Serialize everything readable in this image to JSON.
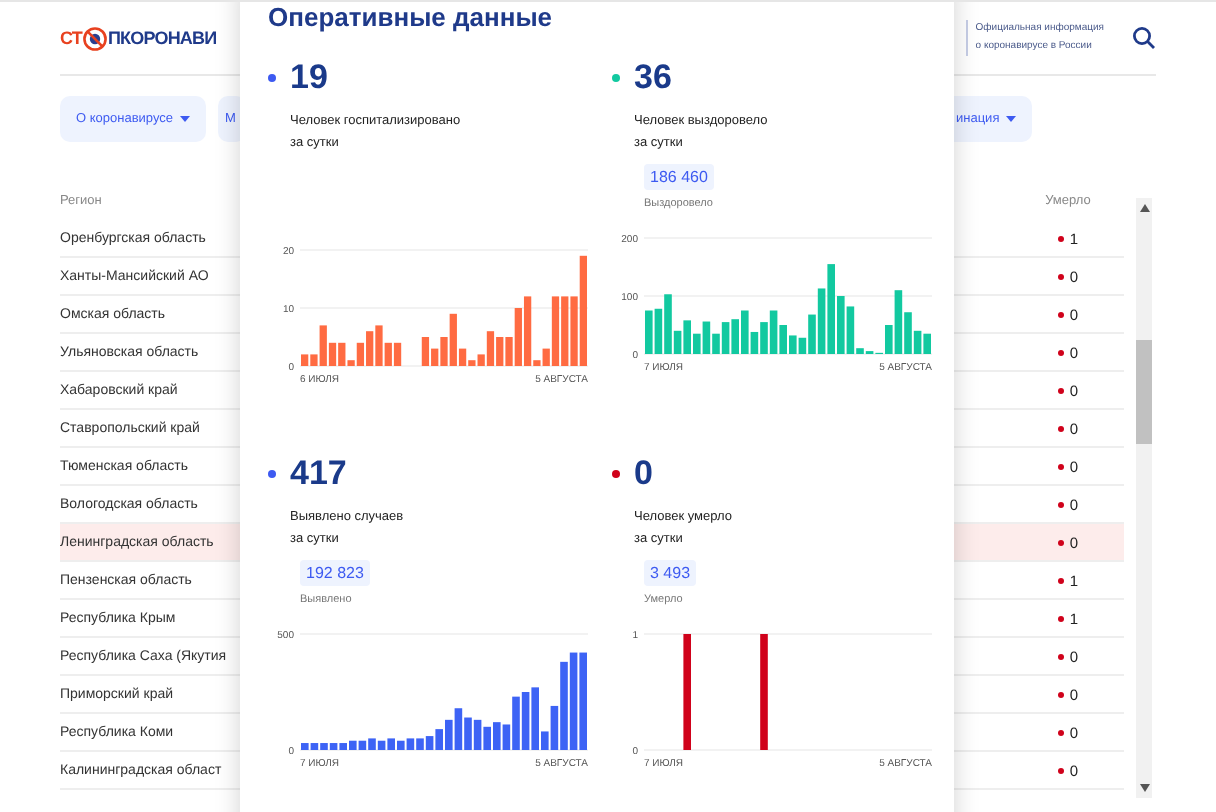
{
  "header": {
    "logo_left": "СТ",
    "logo_right": "ПКОРОНАВИ",
    "tagline": "Официальная информация\nо коронавирусе в России"
  },
  "nav": [
    {
      "label": "О коронавирусе",
      "caret": true
    },
    {
      "label": "М",
      "caret": false
    },
    {
      "label": "инация",
      "caret": true
    }
  ],
  "table": {
    "columns": [
      "Регион",
      "Умерло"
    ],
    "rows": [
      {
        "region": "Оренбургская область",
        "deaths": "1",
        "selected": false
      },
      {
        "region": "Ханты-Мансийский АО",
        "deaths": "0",
        "selected": false
      },
      {
        "region": "Омская область",
        "deaths": "0",
        "selected": false
      },
      {
        "region": "Ульяновская область",
        "deaths": "0",
        "selected": false
      },
      {
        "region": "Хабаровский край",
        "deaths": "0",
        "selected": false
      },
      {
        "region": "Ставропольский край",
        "deaths": "0",
        "selected": false
      },
      {
        "region": "Тюменская область",
        "deaths": "0",
        "selected": false
      },
      {
        "region": "Вологодская область",
        "deaths": "0",
        "selected": false
      },
      {
        "region": "Ленинградская область",
        "deaths": "0",
        "selected": true
      },
      {
        "region": "Пензенская область",
        "deaths": "1",
        "selected": false
      },
      {
        "region": "Республика Крым",
        "deaths": "1",
        "selected": false
      },
      {
        "region": "Республика Саха (Якутия",
        "deaths": "0",
        "selected": false
      },
      {
        "region": "Приморский край",
        "deaths": "0",
        "selected": false
      },
      {
        "region": "Республика Коми",
        "deaths": "0",
        "selected": false
      },
      {
        "region": "Калининградская област",
        "deaths": "0",
        "selected": false
      }
    ]
  },
  "popup": {
    "title": "Оперативные данные",
    "stats": [
      {
        "value": "19",
        "label": "Человек госпитализировано\nза сутки",
        "color": "#3d5af1",
        "axis_start": "6 ИЮЛЯ",
        "axis_end": "5 АВГУСТА",
        "chart_data": {
          "type": "bar",
          "yticks": [
            0,
            10,
            20
          ],
          "ylim": [
            0,
            20
          ],
          "series": [
            {
              "color": "#ff6b42",
              "values": [
                2,
                2,
                7,
                4,
                4,
                1,
                4,
                6,
                7,
                4,
                4,
                null,
                null,
                5,
                3,
                5,
                9,
                3,
                1,
                2,
                6,
                5,
                5,
                10,
                12,
                1,
                3,
                12,
                12,
                12,
                19
              ]
            }
          ]
        }
      },
      {
        "value": "36",
        "label": "Человек выздоровело\nза сутки",
        "total": "186 460",
        "total_label": "Выздоровело",
        "color": "#12c9a0",
        "axis_start": "7 ИЮЛЯ",
        "axis_end": "5 АВГУСТА",
        "chart_data": {
          "type": "bar",
          "yticks": [
            0,
            100,
            200
          ],
          "ylim": [
            0,
            200
          ],
          "series": [
            {
              "color": "#12c9a0",
              "values": [
                75,
                78,
                103,
                40,
                58,
                35,
                56,
                35,
                55,
                60,
                75,
                38,
                55,
                75,
                50,
                32,
                28,
                68,
                113,
                155,
                100,
                82,
                10,
                5,
                2,
                50,
                110,
                72,
                40,
                35
              ]
            }
          ]
        }
      },
      {
        "value": "417",
        "label": "Выявлено случаев\nза сутки",
        "total": "192 823",
        "total_label": "Выявлено",
        "color": "#3d5af1",
        "axis_start": "7 ИЮЛЯ",
        "axis_end": "5 АВГУСТА",
        "chart_data": {
          "type": "bar",
          "yticks": [
            0,
            500
          ],
          "ylim": [
            0,
            500
          ],
          "series": [
            {
              "color": "#3d63f5",
              "values": [
                30,
                30,
                30,
                30,
                30,
                40,
                40,
                50,
                40,
                50,
                40,
                50,
                50,
                60,
                90,
                130,
                180,
                140,
                130,
                100,
                120,
                110,
                230,
                250,
                270,
                80,
                190,
                380,
                420,
                420
              ]
            }
          ]
        }
      },
      {
        "value": "0",
        "label": "Человек умерло\nза сутки",
        "total": "3 493",
        "total_label": "Умерло",
        "color": "#d0021b",
        "axis_start": "7 ИЮЛЯ",
        "axis_end": "5 АВГУСТА",
        "chart_data": {
          "type": "bar",
          "yticks": [
            0,
            1
          ],
          "ylim": [
            0,
            1
          ],
          "series": [
            {
              "color": "#d0021b",
              "values": [
                0,
                0,
                0,
                0,
                1,
                0,
                0,
                0,
                0,
                0,
                0,
                0,
                1,
                0,
                0,
                0,
                0,
                0,
                0,
                0,
                0,
                0,
                0,
                0,
                0,
                0,
                0,
                0,
                0,
                0
              ]
            }
          ]
        }
      }
    ]
  }
}
